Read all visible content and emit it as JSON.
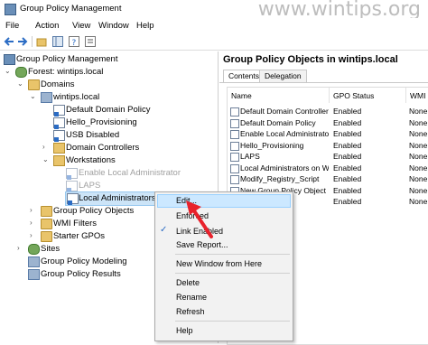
{
  "window": {
    "title": "Group Policy Management",
    "watermark": "www.wintips.org"
  },
  "menubar": [
    "File",
    "Action",
    "View",
    "Window",
    "Help"
  ],
  "tree": {
    "root": "Group Policy Management",
    "forest": "Forest: wintips.local",
    "domains": "Domains",
    "domain": "wintips.local",
    "domain_children": [
      "Default Domain Policy",
      "Hello_Provisioning",
      "USB Disabled"
    ],
    "domain_controllers": "Domain Controllers",
    "workstations": "Workstations",
    "workstation_links": [
      "Enable Local Administrator",
      "LAPS",
      "Local Administrators on Workstations"
    ],
    "group_policy_objects": "Group Policy Objects",
    "wmi_filters": "WMI Filters",
    "starter_gpos": "Starter GPOs",
    "sites": "Sites",
    "modeling": "Group Policy Modeling",
    "results": "Group Policy Results"
  },
  "right_pane": {
    "title": "Group Policy Objects in wintips.local",
    "tabs": [
      "Contents",
      "Delegation"
    ],
    "columns": [
      "Name",
      "GPO Status",
      "WMI"
    ],
    "rows": [
      {
        "name": "Default Domain Controller...",
        "status": "Enabled",
        "wmi": "None"
      },
      {
        "name": "Default Domain Policy",
        "status": "Enabled",
        "wmi": "None"
      },
      {
        "name": "Enable Local Administrator",
        "status": "Enabled",
        "wmi": "None"
      },
      {
        "name": "Hello_Provisioning",
        "status": "Enabled",
        "wmi": "None"
      },
      {
        "name": "LAPS",
        "status": "Enabled",
        "wmi": "None"
      },
      {
        "name": "Local Administrators on W...",
        "status": "Enabled",
        "wmi": "None"
      },
      {
        "name": "Modify_Registry_Script",
        "status": "Enabled",
        "wmi": "None"
      },
      {
        "name": "New Group Policy Object",
        "status": "Enabled",
        "wmi": "None"
      },
      {
        "name": "USB Disabled",
        "status": "Enabled",
        "wmi": "None"
      }
    ]
  },
  "context_menu": {
    "edit": "Edit...",
    "enforced": "Enforced",
    "link_enabled": "Link Enabled",
    "save_report": "Save Report...",
    "new_window": "New Window from Here",
    "delete": "Delete",
    "rename": "Rename",
    "refresh": "Refresh",
    "help": "Help"
  },
  "colors": {
    "highlight": "#cce8ff",
    "arrow": "#e8222c",
    "folder": "#e9c46a"
  }
}
